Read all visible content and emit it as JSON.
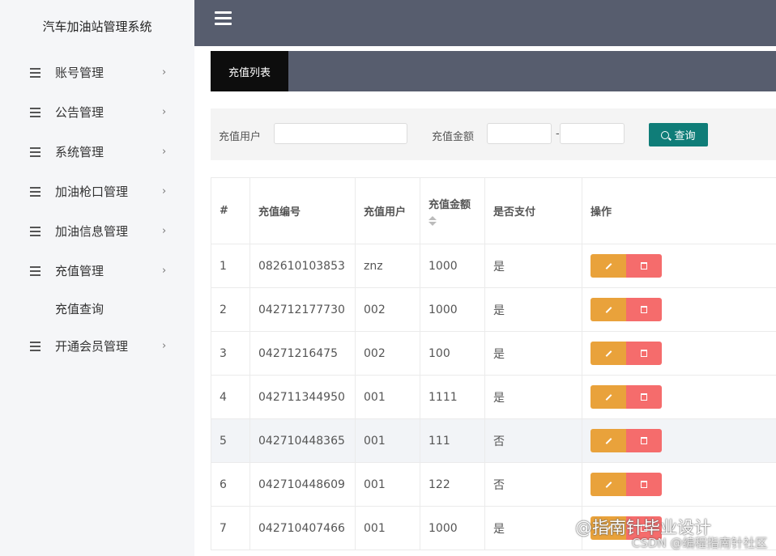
{
  "app": {
    "title": "汽车加油站管理系统"
  },
  "sidebar": {
    "items": [
      {
        "label": "账号管理"
      },
      {
        "label": "公告管理"
      },
      {
        "label": "系统管理"
      },
      {
        "label": "加油枪口管理"
      },
      {
        "label": "加油信息管理"
      },
      {
        "label": "充值管理"
      },
      {
        "label": "开通会员管理"
      }
    ],
    "submenu": {
      "label": "充值查询"
    }
  },
  "tabs": [
    {
      "label": "充值列表",
      "active": true
    }
  ],
  "search": {
    "user_label": "充值用户",
    "user_value": "",
    "amount_label": "充值金额",
    "amount_min": "",
    "amount_max": "",
    "dash": "-",
    "query_label": "查询"
  },
  "table": {
    "headers": [
      "#",
      "充值编号",
      "充值用户",
      "充值金额",
      "是否支付",
      "操作"
    ],
    "rows": [
      [
        "1",
        "082610103853",
        "znz",
        "1000",
        "是"
      ],
      [
        "2",
        "042712177730",
        "002",
        "1000",
        "是"
      ],
      [
        "3",
        "04271216475",
        "002",
        "100",
        "是"
      ],
      [
        "4",
        "042711344950",
        "001",
        "1111",
        "是"
      ],
      [
        "5",
        "042710448365",
        "001",
        "111",
        "否"
      ],
      [
        "6",
        "042710448609",
        "001",
        "122",
        "否"
      ],
      [
        "7",
        "042710407466",
        "001",
        "1000",
        "是"
      ]
    ]
  },
  "watermark": {
    "line1": "@指南针毕业设计",
    "line2": "CSDN @编程指南针社区"
  },
  "colors": {
    "topbar": "#575d6e",
    "primary": "#0f7d78",
    "edit": "#e9a23b",
    "delete": "#f56c6c"
  }
}
